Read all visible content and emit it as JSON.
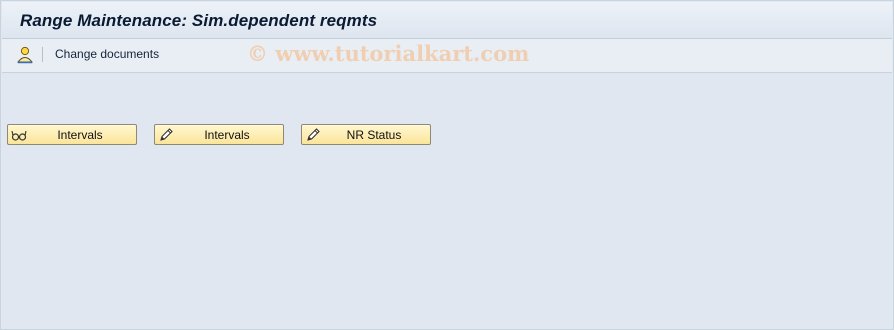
{
  "window": {
    "title": "Range Maintenance: Sim.dependent reqmts"
  },
  "toolbar": {
    "user_icon": "user-icon",
    "change_documents_label": "Change documents"
  },
  "watermark": "© www.tutorialkart.com",
  "buttons": [
    {
      "icon": "glasses-icon",
      "label": "Intervals"
    },
    {
      "icon": "pencil-icon",
      "label": "Intervals"
    },
    {
      "icon": "pencil-icon",
      "label": "NR Status"
    }
  ],
  "colors": {
    "button_fill": "#fbe59a",
    "background": "#e1e7f0",
    "watermark": "#f2c9a6"
  }
}
